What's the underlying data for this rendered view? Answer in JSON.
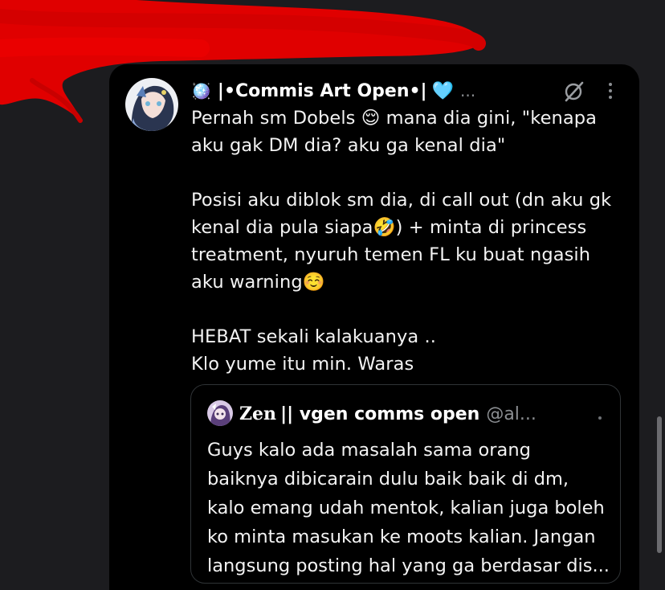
{
  "tweet": {
    "author": {
      "emoji_prefix": "🪩",
      "display_name": "|•Commis Art Open•|",
      "heart": "🩵",
      "more": "..."
    },
    "text_lines": [
      "Pernah sm Dobels 😌 mana dia gini, \"kenapa",
      "aku gak DM dia? aku ga kenal dia\"",
      "",
      "Posisi aku diblok sm dia, di call out (dn aku gk",
      "kenal dia pula siapa🤣) + minta di princess",
      "treatment, nyuruh temen FL ku buat ngasih",
      "aku warning☺️",
      "",
      "HEBAT sekali kalakuanya ..",
      "Klo yume itu min. Waras"
    ]
  },
  "quoted_tweet": {
    "name_styled": "Zen",
    "name_rest": "|| vgen comms open",
    "handle": "@al...",
    "text_lines": [
      "Guys kalo ada masalah sama orang",
      "baiknya dibicarain dulu baik baik di dm,",
      "kalo emang udah mentok, kalian juga boleh",
      "ko minta masukan ke moots kalian. Jangan",
      "langsung posting hal yang ga berdasar dis..."
    ]
  },
  "icons": {
    "grok": "grok-icon",
    "more": "more-vertical-icon"
  },
  "colors": {
    "background": "#1c1c1f",
    "card": "#000000",
    "text": "#f3f3f3",
    "muted": "#8b8e92",
    "redaction": "#e00000",
    "heart": "#58b7ee"
  }
}
